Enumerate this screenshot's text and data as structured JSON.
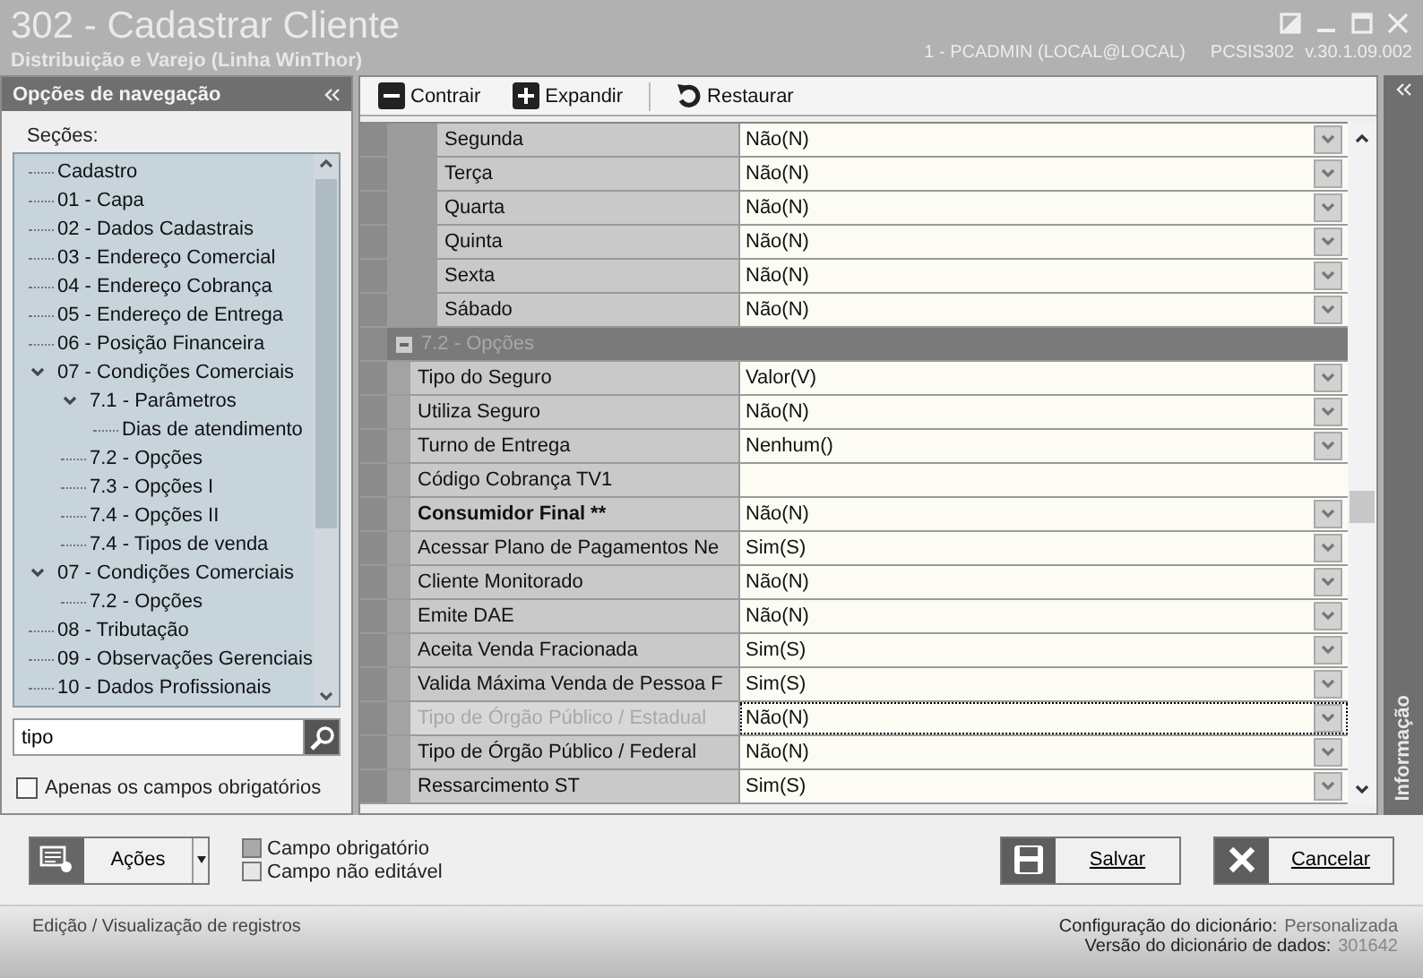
{
  "window": {
    "title": "302 - Cadastrar Cliente",
    "subtitle": "Distribuição e Varejo (Linha WinThor)",
    "user": "1 - PCADMIN (LOCAL@LOCAL)",
    "program": "PCSIS302",
    "version": "v.30.1.09.002"
  },
  "navigation": {
    "title": "Opções de navegação",
    "sections_label": "Seções:",
    "tree": [
      {
        "label": "Cadastro"
      },
      {
        "label": "01 - Capa"
      },
      {
        "label": "02 - Dados Cadastrais"
      },
      {
        "label": "03 - Endereço Comercial"
      },
      {
        "label": "04 - Endereço Cobrança"
      },
      {
        "label": "05 - Endereço de Entrega"
      },
      {
        "label": "06 - Posição Financeira"
      },
      {
        "label": "07 - Condições Comerciais",
        "expanded": true,
        "children": [
          {
            "label": "7.1 - Parâmetros",
            "expanded": true,
            "children": [
              {
                "label": "Dias de atendimento"
              }
            ]
          },
          {
            "label": "7.2 - Opções"
          },
          {
            "label": "7.3 - Opções I"
          },
          {
            "label": "7.4 - Opções II"
          },
          {
            "label": "7.4 - Tipos de venda"
          }
        ]
      },
      {
        "label": "07 - Condições Comerciais",
        "expanded": true,
        "children": [
          {
            "label": "7.2 - Opções"
          }
        ]
      },
      {
        "label": "08 - Tributação"
      },
      {
        "label": "09 - Observações Gerenciais"
      },
      {
        "label": "10 - Dados Profissionais"
      }
    ],
    "search": {
      "value": "tipo"
    },
    "required_only": {
      "label": "Apenas os campos obrigatórios",
      "checked": false
    }
  },
  "toolbar": [
    {
      "label": "Contrair",
      "kind": "collapse"
    },
    {
      "label": "Expandir",
      "kind": "expand"
    },
    {
      "label": "Restaurar",
      "kind": "restore"
    }
  ],
  "grid": {
    "groups": [
      {
        "kind": "subgroup",
        "rows": [
          {
            "label": "Segunda",
            "value": "Não(N)",
            "kind": "dropdown",
            "required": false,
            "disabled": false,
            "selected": false
          },
          {
            "label": "Terça",
            "value": "Não(N)",
            "kind": "dropdown",
            "required": false,
            "disabled": false,
            "selected": false
          },
          {
            "label": "Quarta",
            "value": "Não(N)",
            "kind": "dropdown",
            "required": false,
            "disabled": false,
            "selected": false
          },
          {
            "label": "Quinta",
            "value": "Não(N)",
            "kind": "dropdown",
            "required": false,
            "disabled": false,
            "selected": false
          },
          {
            "label": "Sexta",
            "value": "Não(N)",
            "kind": "dropdown",
            "required": false,
            "disabled": false,
            "selected": false
          },
          {
            "label": "Sábado",
            "value": "Não(N)",
            "kind": "dropdown",
            "required": false,
            "disabled": false,
            "selected": false
          }
        ]
      },
      {
        "kind": "group",
        "title": "7.2 - Opções",
        "expanded": true,
        "rows": [
          {
            "label": "Tipo do Seguro",
            "value": "Valor(V)",
            "kind": "dropdown",
            "required": false,
            "disabled": false,
            "selected": false
          },
          {
            "label": "Utiliza Seguro",
            "value": "Não(N)",
            "kind": "dropdown",
            "required": false,
            "disabled": false,
            "selected": false
          },
          {
            "label": "Turno de Entrega",
            "value": "Nenhum()",
            "kind": "dropdown",
            "required": false,
            "disabled": false,
            "selected": false
          },
          {
            "label": "Código Cobrança TV1",
            "kind": "text",
            "required": false,
            "disabled": false,
            "selected": false
          },
          {
            "label": "Consumidor Final **",
            "value": "Não(N)",
            "kind": "dropdown",
            "required": true,
            "disabled": false,
            "selected": false
          },
          {
            "label": "Acessar Plano de Pagamentos Ne",
            "value": "Sim(S)",
            "kind": "dropdown",
            "required": false,
            "disabled": false,
            "selected": false
          },
          {
            "label": "Cliente Monitorado",
            "value": "Não(N)",
            "kind": "dropdown",
            "required": false,
            "disabled": false,
            "selected": false
          },
          {
            "label": "Emite DAE",
            "value": "Não(N)",
            "kind": "dropdown",
            "required": false,
            "disabled": false,
            "selected": false
          },
          {
            "label": "Aceita Venda Fracionada",
            "value": "Sim(S)",
            "kind": "dropdown",
            "required": false,
            "disabled": false,
            "selected": false
          },
          {
            "label": "Valida Máxima Venda de Pessoa F",
            "value": "Sim(S)",
            "kind": "dropdown",
            "required": false,
            "disabled": false,
            "selected": false
          },
          {
            "label": "Tipo de Órgão Público / Estadual",
            "value": "Não(N)",
            "kind": "dropdown",
            "required": false,
            "disabled": true,
            "selected": true
          },
          {
            "label": "Tipo de Órgão Público / Federal",
            "value": "Não(N)",
            "kind": "dropdown",
            "required": false,
            "disabled": false,
            "selected": false
          },
          {
            "label": "Ressarcimento ST",
            "value": "Sim(S)",
            "kind": "dropdown",
            "required": false,
            "disabled": false,
            "selected": false
          }
        ]
      }
    ]
  },
  "info_panel": {
    "title": "Informação"
  },
  "actions": {
    "label": "Ações"
  },
  "legend": [
    {
      "label": "Campo obrigatório",
      "kind": "required"
    },
    {
      "label": "Campo não editável",
      "kind": "readonly"
    }
  ],
  "buttons": [
    {
      "label": "Salvar",
      "kind": "save"
    },
    {
      "label": "Cancelar",
      "kind": "cancel"
    }
  ],
  "status_bar": {
    "mode": "Edição / Visualização de registros",
    "config_label": "Configuração do dicionário:",
    "config_value": "Personalizada",
    "version_label": "Versão do dicionário de dados:",
    "version_value": "301642"
  }
}
